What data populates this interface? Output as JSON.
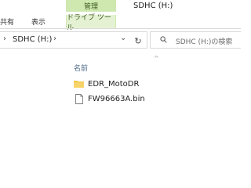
{
  "ribbon": {
    "manage_tab": "管理",
    "window_title": "SDHC (H:)",
    "tabs": [
      "共有",
      "表示",
      "ドライブ ツール"
    ]
  },
  "address_bar": {
    "path": "SDHC (H:)"
  },
  "search": {
    "placeholder": "SDHC (H:)の検索"
  },
  "file_list": {
    "column_name": "名前",
    "items": [
      {
        "name": "EDR_MotoDR",
        "type": "folder"
      },
      {
        "name": "FW96663A.bin",
        "type": "file"
      }
    ]
  },
  "colors": {
    "manage_tab_bg": "#cfe8b0",
    "drive_tab_bg": "#e4f2d3",
    "folder": "#f3c74e"
  },
  "icons": [
    "chevron-right-icon",
    "chevron-down-icon",
    "refresh-icon",
    "search-icon",
    "folder-icon",
    "file-icon",
    "sort-caret-icon"
  ]
}
